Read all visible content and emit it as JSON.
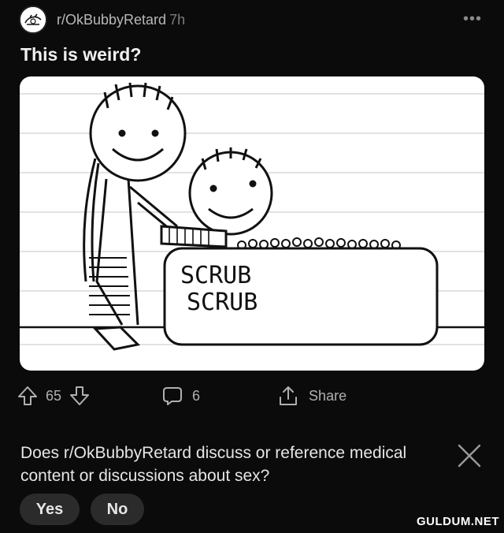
{
  "post": {
    "subreddit": "r/OkBubbyRetard",
    "age": "7h",
    "title": "This is weird?"
  },
  "image": {
    "caption_line1": "SCRUB",
    "caption_line2": "SCRUB"
  },
  "actions": {
    "vote_count": "65",
    "comment_count": "6",
    "share_label": "Share"
  },
  "survey": {
    "question": "Does r/OkBubbyRetard discuss or reference medical content or discussions about sex?",
    "yes_label": "Yes",
    "no_label": "No"
  },
  "watermark": "GULDUM.NET",
  "icons": [
    "subreddit-avatar-icon",
    "more-options-icon",
    "upvote-icon",
    "downvote-icon",
    "comment-icon",
    "share-icon",
    "close-icon"
  ]
}
